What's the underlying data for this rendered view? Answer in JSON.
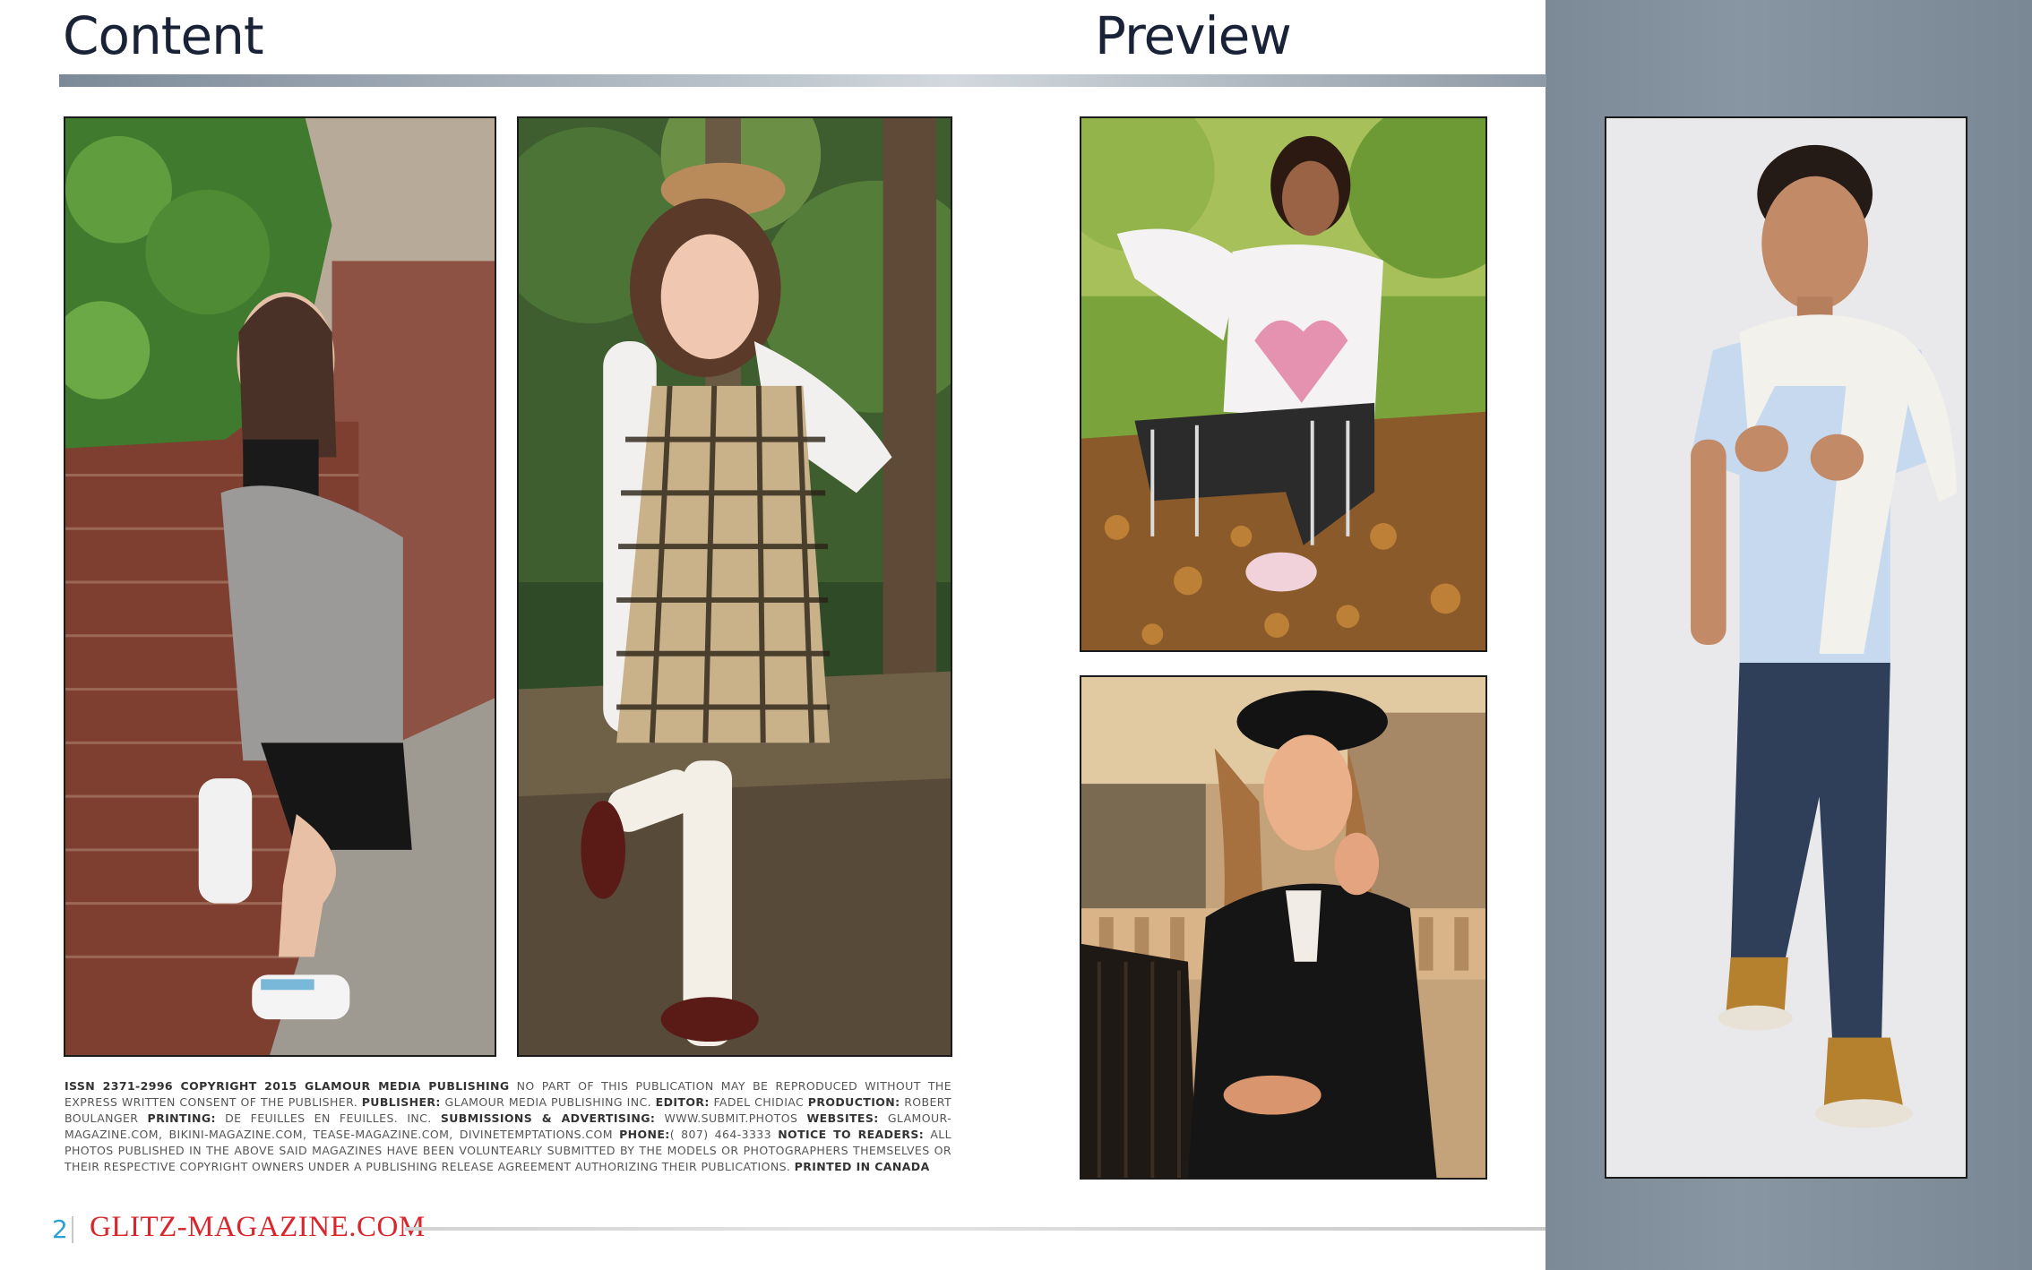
{
  "headings": {
    "content": "Content",
    "preview": "Preview"
  },
  "photos": {
    "photo1": {
      "icon": "girl-leaning-on-brick-wall-photo"
    },
    "photo2": {
      "icon": "girl-in-plaid-dress-beret-photo"
    },
    "photo3": {
      "icon": "girl-kneeling-in-leaves-photo"
    },
    "photo4": {
      "icon": "woman-in-black-beret-sunset-photo"
    },
    "photo5": {
      "icon": "boy-with-sweater-on-shoulders-photo"
    }
  },
  "masthead": {
    "issn": "ISSN 2371-2996 COPYRIGHT 2015 GLAMOUR MEDIA PUBLISHING",
    "notice": "NO PART OF THIS PUBLICATION MAY BE REPRODUCED WITHOUT THE EXPRESS WRITTEN CONSENT OF THE PUBLISHER.",
    "publisher_label": "PUBLISHER:",
    "publisher": "GLAMOUR MEDIA PUBLISHING INC.",
    "editor_label": "EDITOR:",
    "editor": "FADEL CHIDIAC",
    "production_label": "PRODUCTION:",
    "production": "ROBERT BOULANGER",
    "printing_label": "PRINTING:",
    "printing": "DE FEUILLES EN FEUILLES. INC.",
    "submissions_label": "SUBMISSIONS & ADVERTISING:",
    "submissions": "WWW.SUBMIT.PHOTOS",
    "websites_label": "WEBSITES:",
    "websites": "GLAMOUR-MAGAZINE.COM, BIKINI-MAGAZINE.COM, TEASE-MAGAZINE.COM, DIVINETEMPTATIONS.COM",
    "phone_label": "PHONE:",
    "phone": "( 807) 464-3333",
    "readers_label": "NOTICE TO READERS:",
    "readers": "ALL PHOTOS PUBLISHED IN THE ABOVE SAID MAGAZINES HAVE BEEN VOLUNTEARLY SUBMITTED BY THE MODELS OR PHOTOGRAPHERS THEMSELVES OR THEIR RESPECTIVE COPYRIGHT OWNERS UNDER A PUBLISHING RELEASE AGREEMENT AUTHORIZING THEIR PUBLICATIONS.",
    "printed": "PRINTED IN CANADA"
  },
  "footer": {
    "page_number": "2",
    "brand": "GLITZ-MAGAZINE.COM"
  },
  "colors": {
    "page_number": "#2aa2d8",
    "brand": "#d8262c",
    "heading": "#1a2238",
    "side_panel": "#7c8997"
  }
}
